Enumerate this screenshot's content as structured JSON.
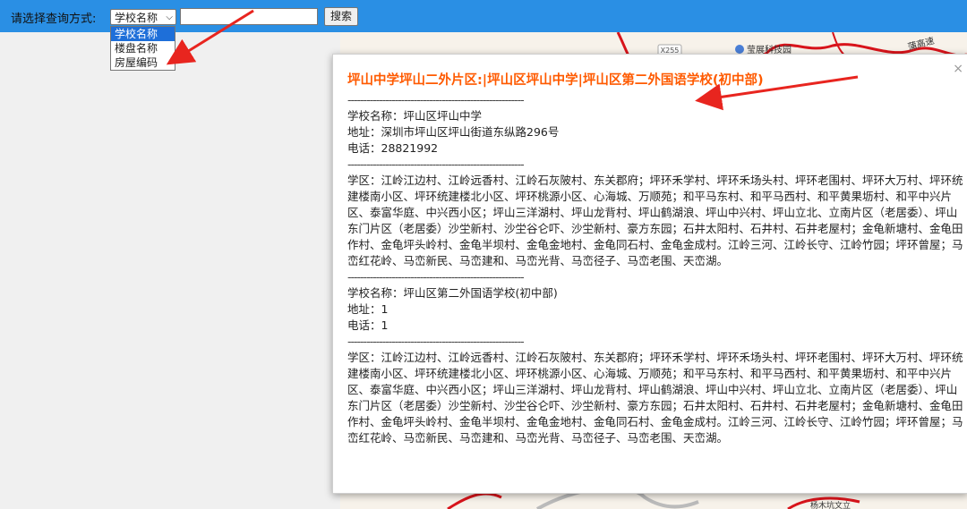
{
  "toolbar": {
    "query_label": "请选择查询方式:",
    "select_value": "学校名称",
    "search_input_value": "",
    "search_button": "搜索"
  },
  "dropdown": {
    "options": [
      "学校名称",
      "楼盘名称",
      "房屋编码"
    ],
    "selected_index": 0
  },
  "map": {
    "labels": [
      "X255",
      "莹展科技园",
      "蒲高速",
      "杨木坑文立"
    ]
  },
  "popup": {
    "close": "×",
    "title": "坪山中学坪山二外片区:|坪山区坪山中学|坪山区第二外国语学校(初中部)",
    "separator": "--------------------------------------------------------",
    "schools": [
      {
        "name_line": "学校名称：坪山区坪山中学",
        "address_line": "地址：深圳市坪山区坪山街道东纵路296号",
        "phone_line": "电话：28821992",
        "district": "学区：江岭江边村、江岭远香村、江岭石灰陂村、东关郡府；坪环禾学村、坪环禾场头村、坪环老围村、坪环大万村、坪环统建楼南小区、坪环统建楼北小区、坪环桃源小区、心海城、万顺苑；和平马东村、和平马西村、和平黄果坜村、和平中兴片区、泰富华庭、中兴西小区；坪山三洋湖村、坪山龙背村、坪山鹤湖浪、坪山中兴村、坪山立北、立南片区（老居委）、坪山东门片区（老居委）沙坣新村、沙坣谷仑吓、沙坣新村、豪方东园；石井太阳村、石井村、石井老屋村；金龟新塘村、金龟田作村、金龟坪头岭村、金龟半坝村、金龟金地村、金龟同石村、金龟金成村。江岭三河、江岭长守、江岭竹园；坪环曾屋；马峦红花岭、马峦新民、马峦建和、马峦光背、马峦径子、马峦老围、天峦湖。"
      },
      {
        "name_line": "学校名称：坪山区第二外国语学校(初中部)",
        "address_line": "地址：1",
        "phone_line": "电话：1",
        "district": "学区：江岭江边村、江岭远香村、江岭石灰陂村、东关郡府；坪环禾学村、坪环禾场头村、坪环老围村、坪环大万村、坪环统建楼南小区、坪环统建楼北小区、坪环桃源小区、心海城、万顺苑；和平马东村、和平马西村、和平黄果坜村、和平中兴片区、泰富华庭、中兴西小区；坪山三洋湖村、坪山龙背村、坪山鹤湖浪、坪山中兴村、坪山立北、立南片区（老居委）、坪山东门片区（老居委）沙坣新村、沙坣谷仑吓、沙坣新村、豪方东园；石井太阳村、石井村、石井老屋村；金龟新塘村、金龟田作村、金龟坪头岭村、金龟半坝村、金龟金地村、金龟同石村、金龟金成村。江岭三河、江岭长守、江岭竹园；坪环曾屋；马峦红花岭、马峦新民、马峦建和、马峦光背、马峦径子、马峦老围、天峦湖。"
      }
    ]
  },
  "colors": {
    "topbar": "#2a8fe4",
    "title": "#ff5a00",
    "annotation_arrow": "#e8251f",
    "map_road": "#d8141b"
  }
}
